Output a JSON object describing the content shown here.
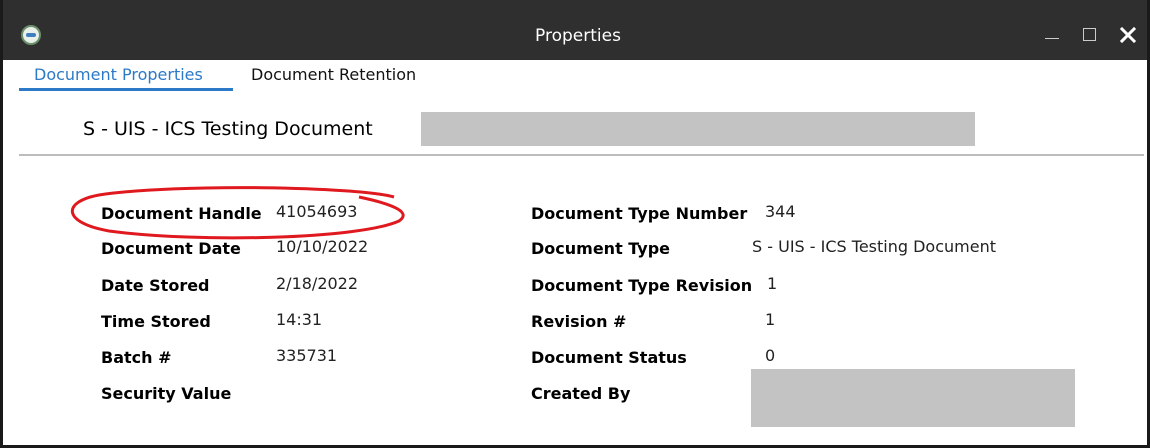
{
  "window": {
    "title": "Properties",
    "app_icon": "app-logo-icon",
    "controls": [
      "minimize-icon",
      "maximize-icon",
      "close-icon"
    ]
  },
  "tabs": [
    {
      "label": "Document Properties",
      "active": true
    },
    {
      "label": "Document Retention",
      "active": false
    }
  ],
  "document": {
    "title": "S - UIS - ICS Testing Document"
  },
  "left_properties": [
    {
      "label": "Document Handle",
      "value": "41054693"
    },
    {
      "label": "Document Date",
      "value": "10/10/2022"
    },
    {
      "label": "Date Stored",
      "value": "2/18/2022"
    },
    {
      "label": "Time Stored",
      "value": "14:31"
    },
    {
      "label": "Batch #",
      "value": "335731"
    },
    {
      "label": "Security Value",
      "value": ""
    }
  ],
  "right_properties": [
    {
      "label": "Document Type Number",
      "value": "344"
    },
    {
      "label": "Document Type",
      "value": "S - UIS - ICS Testing Document"
    },
    {
      "label": "Document Type Revision",
      "value": "1"
    },
    {
      "label": "Revision #",
      "value": "1"
    },
    {
      "label": "Document Status",
      "value": "0"
    },
    {
      "label": "Created By",
      "value": ""
    }
  ],
  "colors": {
    "title_bar": "#2f2f2f",
    "active_tab": "#2c7ac7",
    "redaction": "#c3c3c3",
    "highlight_circle": "#e0191f"
  }
}
